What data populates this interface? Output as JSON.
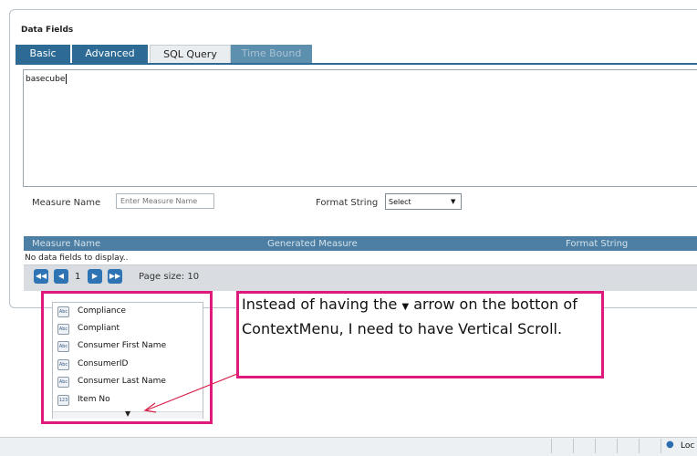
{
  "panel": {
    "title": "Data Fields"
  },
  "tabs": [
    {
      "label": "Basic"
    },
    {
      "label": "Advanced"
    },
    {
      "label": "SQL Query"
    },
    {
      "label": "Time Bound"
    }
  ],
  "sql": {
    "value": "basecube"
  },
  "measure": {
    "label": "Measure Name",
    "placeholder": "Enter Measure Name",
    "format_label": "Format String",
    "format_value": "Select"
  },
  "grid": {
    "columns": [
      "Measure Name",
      "Generated Measure",
      "Format String"
    ],
    "empty_text": "No data fields to display.."
  },
  "pager": {
    "current_page": "1",
    "page_size_label": "Page size:",
    "page_size": "10"
  },
  "context_menu": {
    "items": [
      {
        "icon": "Abc",
        "label": "Compliance"
      },
      {
        "icon": "Abc",
        "label": "Compliant"
      },
      {
        "icon": "Abc",
        "label": "Consumer First Name"
      },
      {
        "icon": "Abc",
        "label": "ConsumerID"
      },
      {
        "icon": "Abc",
        "label": "Consumer Last Name"
      },
      {
        "icon": "123",
        "label": "Item No"
      }
    ]
  },
  "annotation": {
    "text_before": "Instead of having the ",
    "arrow_glyph": "▼",
    "text_after": " arrow on the botton of ContextMenu, I need to have Vertical Scroll."
  },
  "status_bar": {
    "label": "Loc"
  },
  "colors": {
    "accent": "#2d6b95",
    "highlight": "#e0197d"
  }
}
